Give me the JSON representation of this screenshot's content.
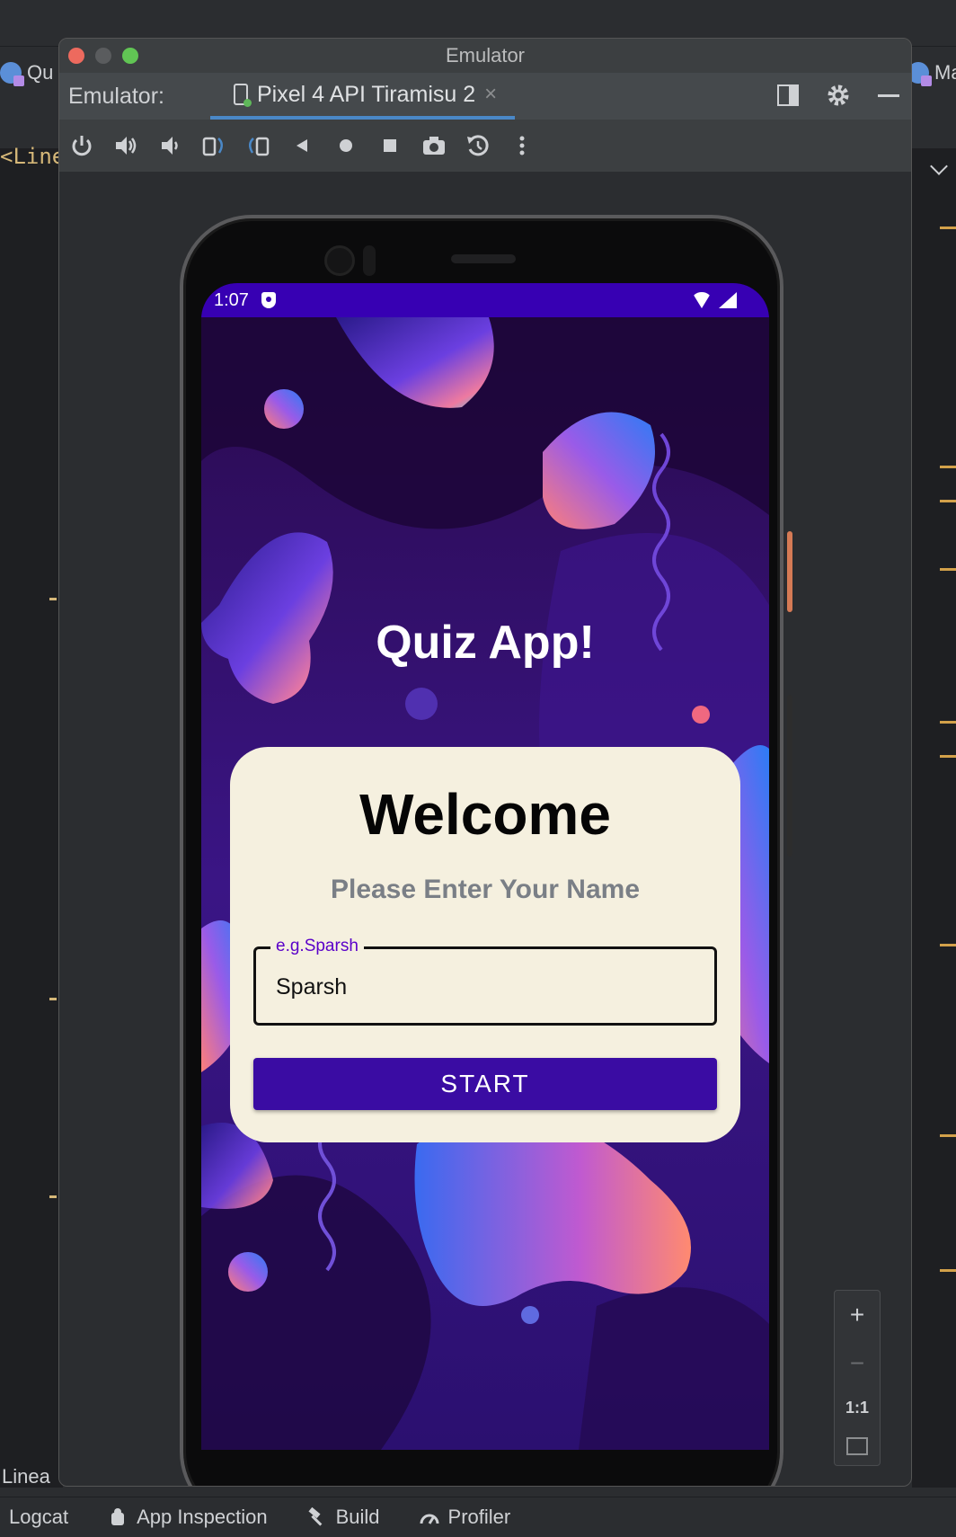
{
  "ide": {
    "left_tab_label": "Qu",
    "right_tab_label": "Ma",
    "code_fragment": "<Line",
    "layout_label": "Linea",
    "bottom_items": [
      "Logcat",
      "App Inspection",
      "Build",
      "Profiler"
    ]
  },
  "emulator": {
    "window_title": "Emulator",
    "label": "Emulator:",
    "device_tab": "Pixel 4 API Tiramisu 2",
    "tab_close": "×",
    "toolbar_icons": [
      "power-icon",
      "volume-up-icon",
      "volume-down-icon",
      "rotate-left-icon",
      "rotate-right-icon",
      "back-icon",
      "home-icon",
      "overview-icon",
      "screenshot-icon",
      "snapshot-icon",
      "more-icon"
    ],
    "zoom": {
      "plus": "+",
      "minus": "−",
      "one_to_one": "1:1"
    }
  },
  "phone": {
    "status_time": "1:07",
    "colors": {
      "status_bar": "#3700b3",
      "button": "#3a0ca3",
      "card": "#f5f0df"
    }
  },
  "app": {
    "title": "Quiz App!",
    "welcome": "Welcome",
    "subtitle": "Please Enter Your Name",
    "name_field": {
      "label": "e.g.Sparsh",
      "value": "Sparsh"
    },
    "start_button": "START"
  }
}
